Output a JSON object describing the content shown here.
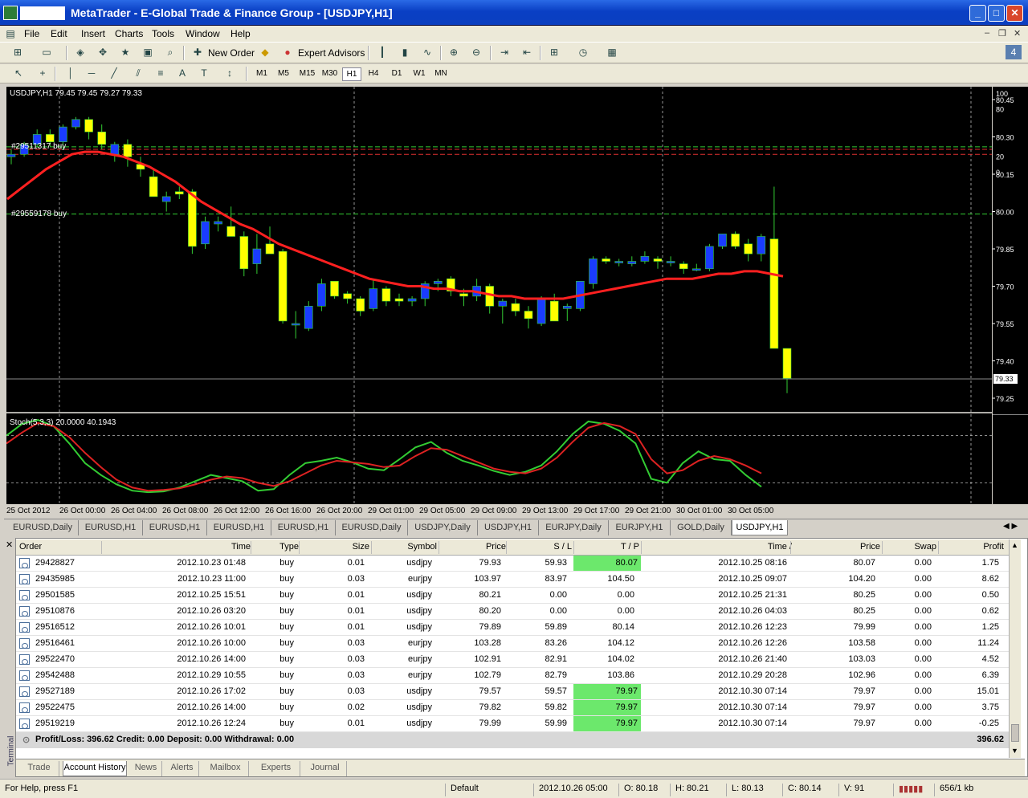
{
  "window": {
    "title": "MetaTrader - E-Global Trade & Finance Group - [USDJPY,H1]"
  },
  "menu": [
    "File",
    "Edit",
    "Insert",
    "Charts",
    "Tools",
    "Window",
    "Help"
  ],
  "toolbar": {
    "new_order": "New Order",
    "expert_advisors": "Expert Advisors"
  },
  "timeframes": [
    "M1",
    "M5",
    "M15",
    "M30",
    "H1",
    "H4",
    "D1",
    "W1",
    "MN"
  ],
  "selected_timeframe": "H1",
  "chart": {
    "header": "USDJPY,H1  79.45 79.45 79.27 79.33",
    "order_labels": [
      "#29511317 buy",
      "#29559178 buy"
    ],
    "price_labels": [
      "80.45",
      "80.30",
      "80.15",
      "80.00",
      "79.85",
      "79.70",
      "79.55",
      "79.40",
      "79.25"
    ],
    "current_price": "79.33",
    "stoch_header": "Stoch(5,3,3) 20.0000 40.1943",
    "stoch_labels": [
      "100",
      "80",
      "20",
      "0"
    ],
    "time_labels": [
      "25 Oct 2012",
      "26 Oct 00:00",
      "26 Oct 04:00",
      "26 Oct 08:00",
      "26 Oct 12:00",
      "26 Oct 16:00",
      "26 Oct 20:00",
      "29 Oct 01:00",
      "29 Oct 05:00",
      "29 Oct 09:00",
      "29 Oct 13:00",
      "29 Oct 17:00",
      "29 Oct 21:00",
      "30 Oct 01:00",
      "30 Oct 05:00"
    ]
  },
  "chart_tabs": [
    "EURUSD,Daily",
    "EURUSD,H1",
    "EURUSD,H1",
    "EURUSD,H1",
    "EURUSD,H1",
    "EURUSD,Daily",
    "USDJPY,Daily",
    "USDJPY,H1",
    "EURJPY,Daily",
    "EURJPY,H1",
    "GOLD,Daily",
    "USDJPY,H1"
  ],
  "selected_chart_tab": 11,
  "history": {
    "columns": [
      "Order",
      "Time",
      "Type",
      "Size",
      "Symbol",
      "Price",
      "S / L",
      "T / P",
      "Time",
      "Price",
      "Swap",
      "Profit"
    ],
    "rows": [
      [
        "29428827",
        "2012.10.23 01:48",
        "buy",
        "0.01",
        "usdjpy",
        "79.93",
        "59.93",
        "80.07",
        "2012.10.25 08:16",
        "80.07",
        "0.00",
        "1.75"
      ],
      [
        "29435985",
        "2012.10.23 11:00",
        "buy",
        "0.03",
        "eurjpy",
        "103.97",
        "83.97",
        "104.50",
        "2012.10.25 09:07",
        "104.20",
        "0.00",
        "8.62"
      ],
      [
        "29501585",
        "2012.10.25 15:51",
        "buy",
        "0.01",
        "usdjpy",
        "80.21",
        "0.00",
        "0.00",
        "2012.10.25 21:31",
        "80.25",
        "0.00",
        "0.50"
      ],
      [
        "29510876",
        "2012.10.26 03:20",
        "buy",
        "0.01",
        "usdjpy",
        "80.20",
        "0.00",
        "0.00",
        "2012.10.26 04:03",
        "80.25",
        "0.00",
        "0.62"
      ],
      [
        "29516512",
        "2012.10.26 10:01",
        "buy",
        "0.01",
        "usdjpy",
        "79.89",
        "59.89",
        "80.14",
        "2012.10.26 12:23",
        "79.99",
        "0.00",
        "1.25"
      ],
      [
        "29516461",
        "2012.10.26 10:00",
        "buy",
        "0.03",
        "eurjpy",
        "103.28",
        "83.26",
        "104.12",
        "2012.10.26 12:26",
        "103.58",
        "0.00",
        "11.24"
      ],
      [
        "29522470",
        "2012.10.26 14:00",
        "buy",
        "0.03",
        "eurjpy",
        "102.91",
        "82.91",
        "104.02",
        "2012.10.26 21:40",
        "103.03",
        "0.00",
        "4.52"
      ],
      [
        "29542488",
        "2012.10.29 10:55",
        "buy",
        "0.03",
        "eurjpy",
        "102.79",
        "82.79",
        "103.86",
        "2012.10.29 20:28",
        "102.96",
        "0.00",
        "6.39"
      ],
      [
        "29527189",
        "2012.10.26 17:02",
        "buy",
        "0.03",
        "usdjpy",
        "79.57",
        "59.57",
        "79.97",
        "2012.10.30 07:14",
        "79.97",
        "0.00",
        "15.01"
      ],
      [
        "29522475",
        "2012.10.26 14:00",
        "buy",
        "0.02",
        "usdjpy",
        "79.82",
        "59.82",
        "79.97",
        "2012.10.30 07:14",
        "79.97",
        "0.00",
        "3.75"
      ],
      [
        "29519219",
        "2012.10.26 12:24",
        "buy",
        "0.01",
        "usdjpy",
        "79.99",
        "59.99",
        "79.97",
        "2012.10.30 07:14",
        "79.97",
        "0.00",
        "-0.25"
      ]
    ],
    "tp_hit_rows": [
      0,
      8,
      9,
      10
    ],
    "summary": "Profit/Loss: 396.62  Credit: 0.00  Deposit: 0.00  Withdrawal: 0.00",
    "summary_total": "396.62"
  },
  "terminal_label": "Terminal",
  "bottom_tabs": [
    "Trade",
    "Account History",
    "News",
    "Alerts",
    "Mailbox",
    "Experts",
    "Journal"
  ],
  "selected_bottom_tab": 1,
  "status": {
    "help": "For Help, press F1",
    "profile": "Default",
    "time": "2012.10.26 05:00",
    "open": "O: 80.18",
    "high": "H: 80.21",
    "low": "L: 80.13",
    "close": "C: 80.14",
    "volume": "V: 91",
    "traffic": "656/1 kb"
  },
  "colors": {
    "bull_candle": "#1a3cff",
    "bear_candle": "#ffff00",
    "ma_line": "#ff2020",
    "stoch_main": "#33cc33",
    "stoch_signal": "#dd2222",
    "tp_hit": "#6ce86c"
  }
}
